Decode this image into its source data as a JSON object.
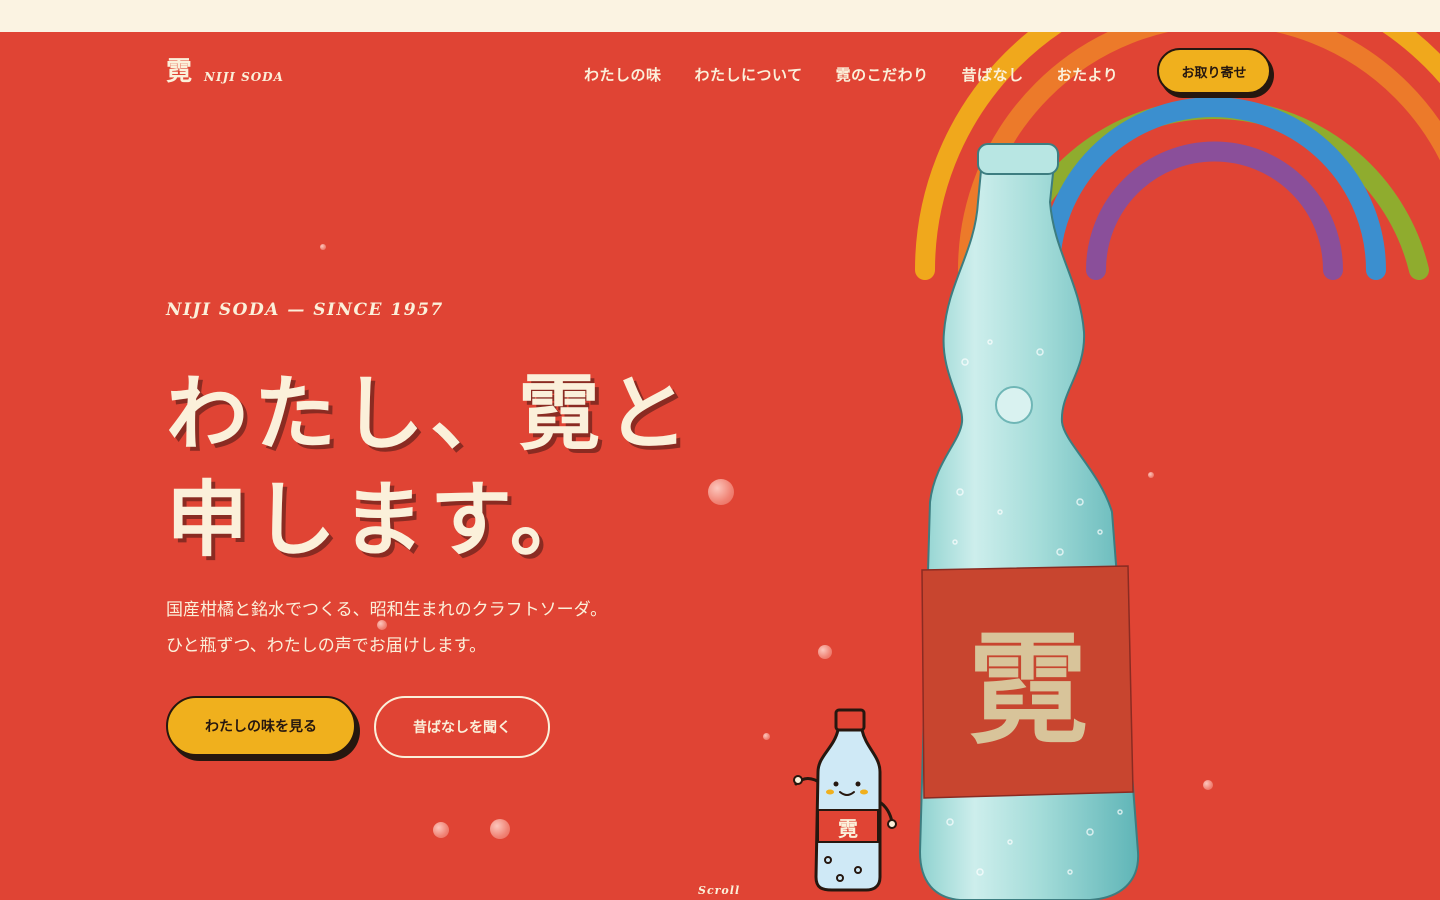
{
  "header": {
    "logo_kanji": "霓",
    "logo_text": "NIJI SODA",
    "nav": [
      "わたしの味",
      "わたしについて",
      "霓のこだわり",
      "昔ばなし",
      "おたより"
    ],
    "order_button": "お取り寄せ"
  },
  "hero": {
    "eyebrow": "NIJI SODA — SINCE 1957",
    "headline_line1": "わたし、霓と",
    "headline_line2": "申します。",
    "lead_line1": "国産柑橘と銘水でつくる、昭和生まれのクラフトソーダ。",
    "lead_line2": "ひと瓶ずつ、わたしの声でお届けします。",
    "primary_button": "わたしの味を見る",
    "secondary_button": "昔ばなしを聞く",
    "scroll_label": "Scroll",
    "bottle_label": "霓",
    "mascot_label": "霓"
  },
  "colors": {
    "background": "#e04434",
    "topstrip": "#fbf3e2",
    "cream": "#fbf0da",
    "accent_yellow": "#f0b01d",
    "ink": "#26170f",
    "rainbow": [
      "#f0a81c",
      "#ec7a2a",
      "#8fac2e",
      "#3b8fcf",
      "#8a4f9a"
    ]
  },
  "icons": {
    "rainbow": "rainbow-illustration",
    "bottle": "ramune-bottle-illustration",
    "mascot": "bottle-mascot-illustration"
  }
}
